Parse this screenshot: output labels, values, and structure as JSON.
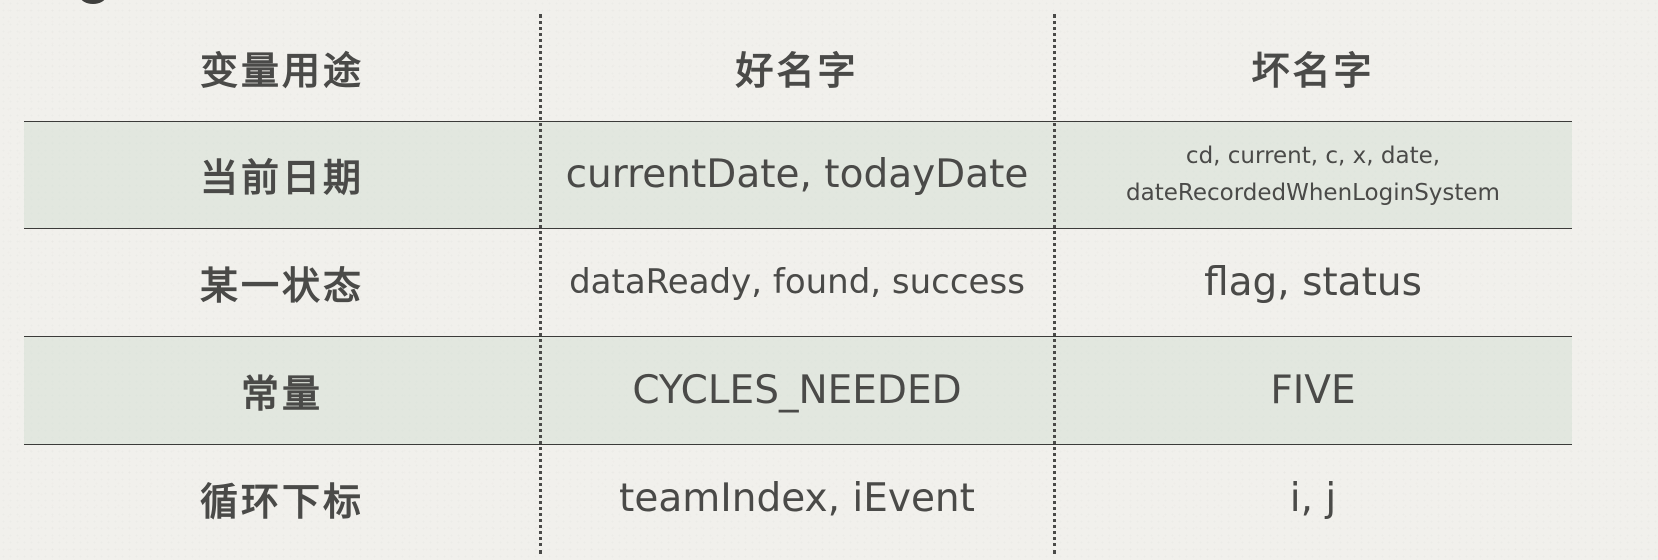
{
  "table": {
    "headers": [
      "变量用途",
      "好名字",
      "坏名字"
    ],
    "rows": [
      {
        "purpose": "当前日期",
        "good": "currentDate, todayDate",
        "bad_line1": "cd, current, c, x, date,",
        "bad_line2": "dateRecordedWhenLoginSystem"
      },
      {
        "purpose": "某一状态",
        "good": "dataReady, found, success",
        "bad": "flag, status"
      },
      {
        "purpose": "常量",
        "good": "CYCLES_NEEDED",
        "bad": "FIVE"
      },
      {
        "purpose": "循环下标",
        "good": "teamIndex, iEvent",
        "bad": "i, j"
      }
    ]
  }
}
